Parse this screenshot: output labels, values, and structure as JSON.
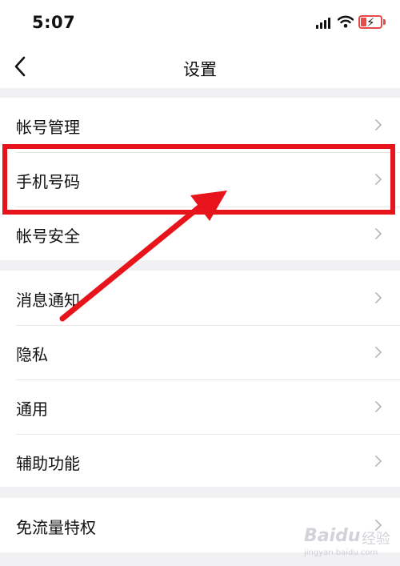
{
  "status_bar": {
    "time": "5:07",
    "signal_icon": "cellular-signal-icon",
    "wifi_icon": "wifi-icon",
    "battery_icon": "battery-charging-icon",
    "battery_color": "#e84a4a"
  },
  "nav": {
    "title": "设置",
    "back_icon": "chevron-left-icon"
  },
  "groups": [
    {
      "items": [
        {
          "label": "帐号管理"
        },
        {
          "label": "手机号码"
        },
        {
          "label": "帐号安全"
        }
      ]
    },
    {
      "items": [
        {
          "label": "消息通知"
        },
        {
          "label": "隐私"
        },
        {
          "label": "通用"
        },
        {
          "label": "辅助功能"
        }
      ]
    },
    {
      "items": [
        {
          "label": "免流量特权"
        }
      ]
    }
  ],
  "annotation": {
    "highlight_color": "#e8141b",
    "highlighted_item": "手机号码"
  },
  "watermark": {
    "brand": "Baidu",
    "brand_cn": "经验",
    "url": "jingyan.baidu.com"
  },
  "colors": {
    "background": "#f1f1f3",
    "surface": "#ffffff",
    "text": "#111111",
    "chevron": "#b9b9bd"
  }
}
